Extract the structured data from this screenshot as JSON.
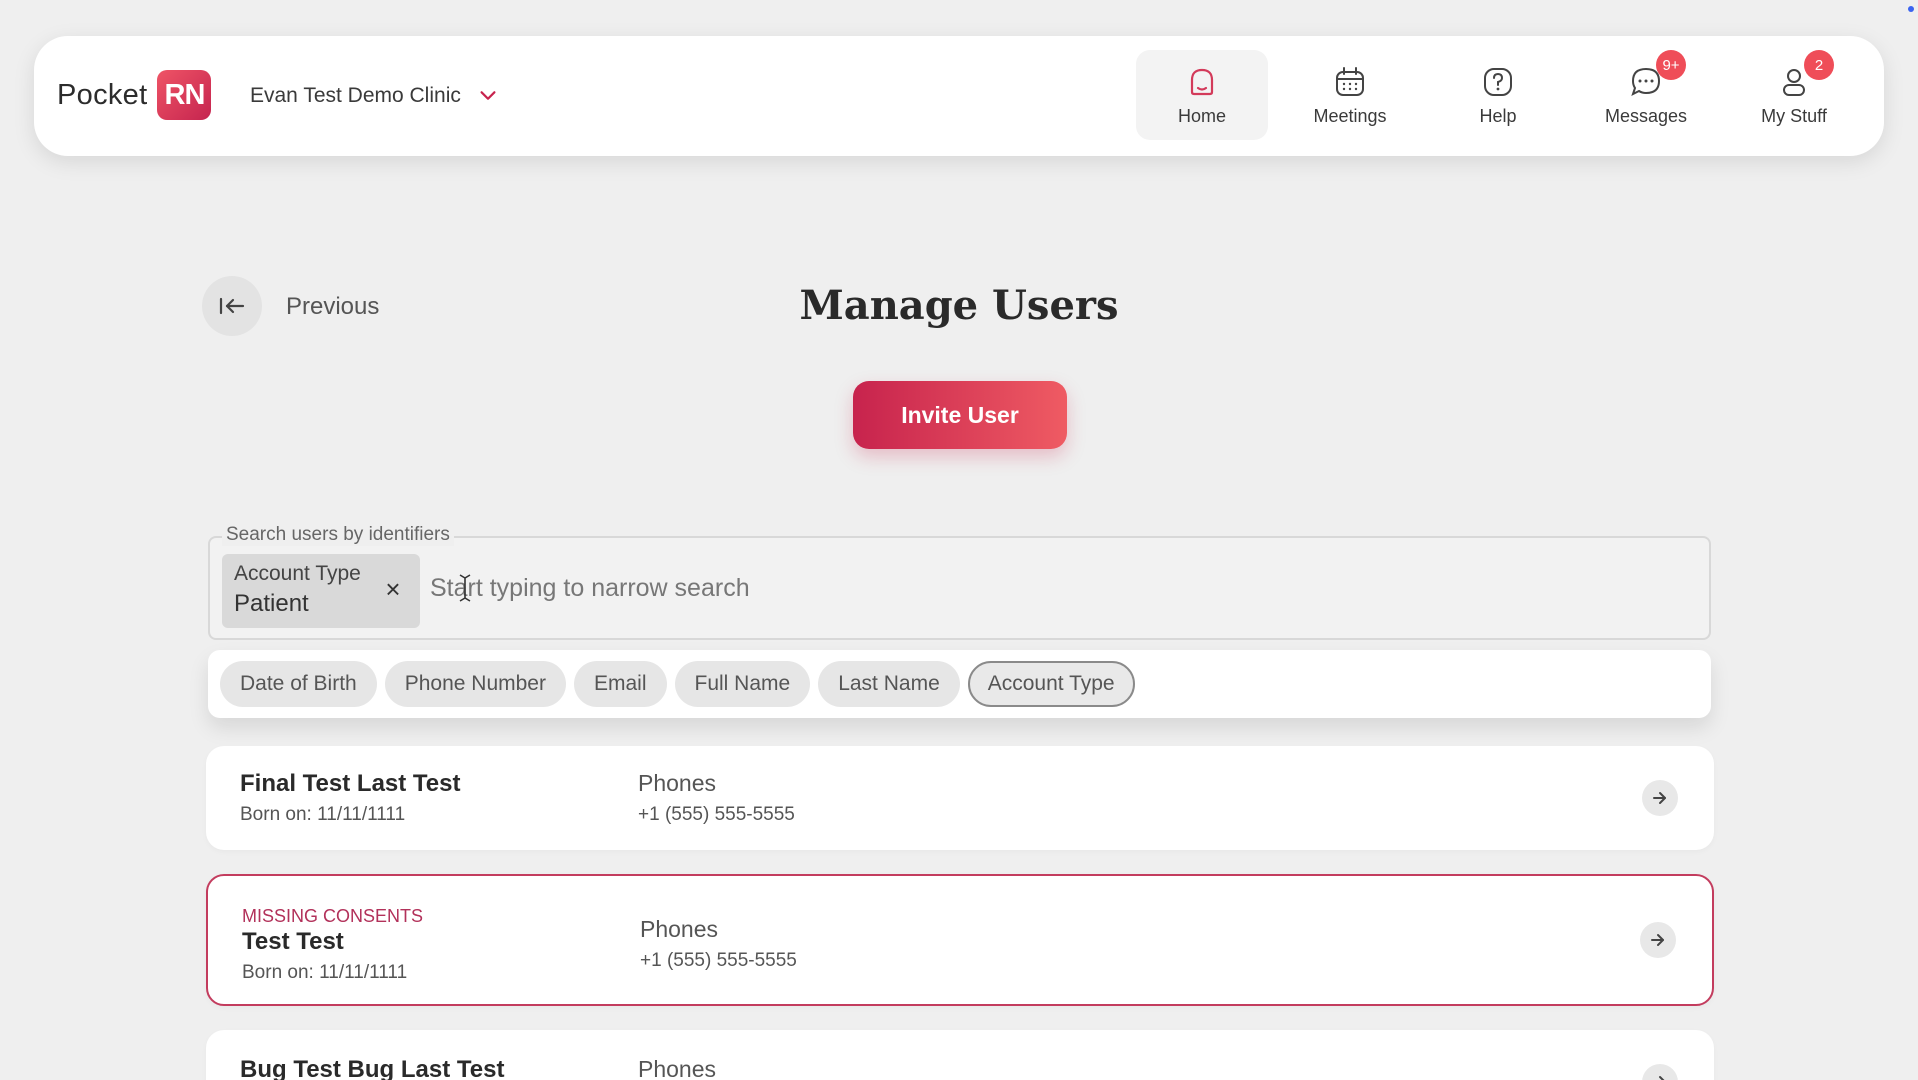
{
  "header": {
    "logo_text": "Pocket",
    "logo_badge": "RN",
    "clinic_name": "Evan Test Demo Clinic",
    "nav": [
      {
        "label": "Home",
        "icon": "home-icon",
        "active": true
      },
      {
        "label": "Meetings",
        "icon": "calendar-icon"
      },
      {
        "label": "Help",
        "icon": "help-icon"
      },
      {
        "label": "Messages",
        "icon": "chat-icon",
        "badge": "9+"
      },
      {
        "label": "My Stuff",
        "icon": "user-icon",
        "badge": "2"
      }
    ]
  },
  "page": {
    "back_label": "Previous",
    "title": "Manage Users",
    "invite_label": "Invite User"
  },
  "search": {
    "legend": "Search users by identifiers",
    "chip_key": "Account Type",
    "chip_value": "Patient",
    "placeholder": "Start typing to narrow search",
    "filters": [
      "Date of Birth",
      "Phone Number",
      "Email",
      "Full Name",
      "Last Name",
      "Account Type"
    ],
    "selected_filter": "Account Type"
  },
  "users": [
    {
      "name": "Final Test Last Test",
      "dob": "Born on: 11/11/1111",
      "phones_label": "Phones",
      "phone": "+1 (555) 555-5555"
    },
    {
      "flag": "MISSING CONSENTS",
      "name": "Test Test",
      "dob": "Born on: 11/11/1111",
      "phones_label": "Phones",
      "phone": "+1 (555) 555-5555"
    },
    {
      "name": "Bug Test Bug Last Test",
      "phones_label": "Phones"
    }
  ],
  "colors": {
    "accent": "#c7234d",
    "accent_light": "#ef5b63",
    "badge": "#ef4d58",
    "flag": "#b2315a",
    "background": "#efefef"
  }
}
